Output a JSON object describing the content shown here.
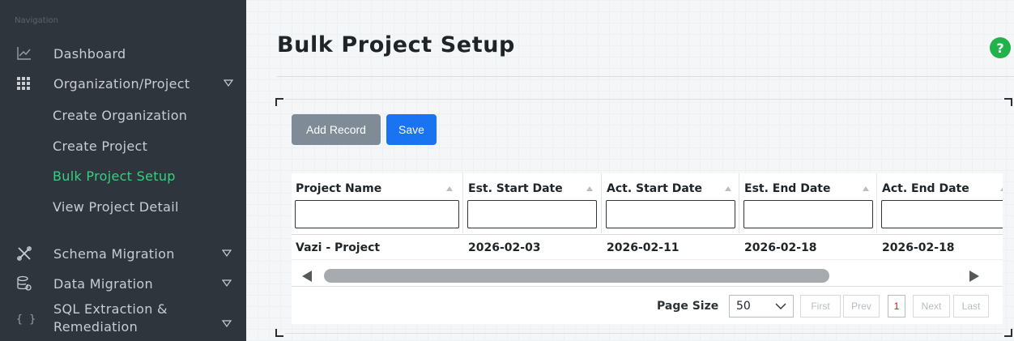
{
  "sidebar": {
    "heading": "Navigation",
    "items": [
      {
        "label": "Dashboard",
        "icon": "chart-line-icon"
      },
      {
        "label": "Organization/Project",
        "icon": "grid-icon",
        "expanded": true,
        "children": [
          {
            "label": "Create Organization"
          },
          {
            "label": "Create Project"
          },
          {
            "label": "Bulk Project Setup",
            "active": true
          },
          {
            "label": "View Project Detail"
          }
        ]
      },
      {
        "label": "Schema Migration",
        "icon": "tools-icon"
      },
      {
        "label": "Data Migration",
        "icon": "database-settings-icon"
      },
      {
        "label": "SQL Extraction & Remediation",
        "icon": "braces-icon"
      }
    ]
  },
  "main": {
    "title": "Bulk Project Setup",
    "help_label": "?",
    "toolbar": {
      "add_label": "Add Record",
      "save_label": "Save"
    },
    "grid": {
      "columns": [
        "Project Name",
        "Est. Start Date",
        "Act. Start Date",
        "Est. End Date",
        "Act. End Date"
      ],
      "rows": [
        [
          "Vazi - Project",
          "2026-02-03",
          "2026-02-11",
          "2026-02-18",
          "2026-02-18"
        ]
      ]
    },
    "pager": {
      "page_size_label": "Page Size",
      "page_size": "50",
      "first": "First",
      "prev": "Prev",
      "current_page": "1",
      "next": "Next",
      "last": "Last"
    }
  },
  "colors": {
    "sidebar_bg": "#2f353d",
    "active_link": "#35d07f",
    "save_button": "#1a73f0",
    "add_button": "#7f8c98",
    "help_icon": "#22b24c",
    "current_page": "#d0121b"
  }
}
